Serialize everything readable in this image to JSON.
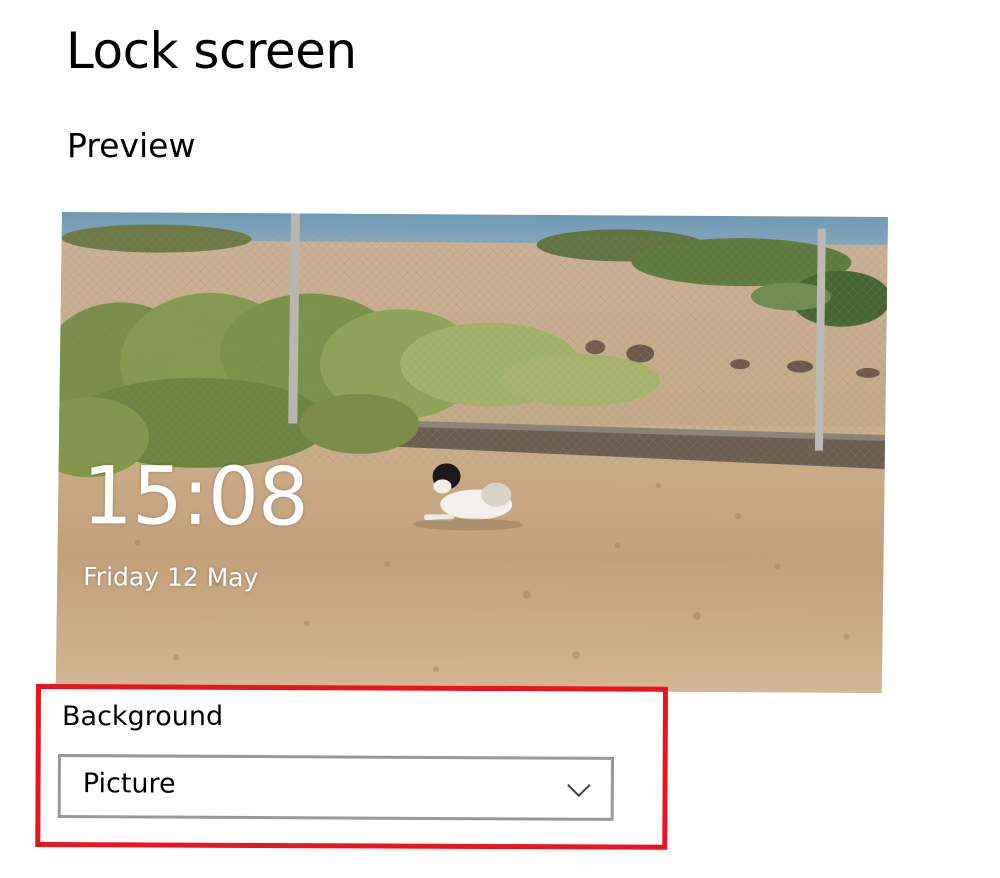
{
  "header": {
    "title": "Lock screen"
  },
  "preview": {
    "section_title": "Preview",
    "time": "15:08",
    "date": "Friday 12 May"
  },
  "background": {
    "label": "Background",
    "selected": "Picture"
  },
  "icons": {
    "dropdown": "chevron-down-icon"
  },
  "colors": {
    "highlight": "#e8141f",
    "select_border": "#999999"
  }
}
